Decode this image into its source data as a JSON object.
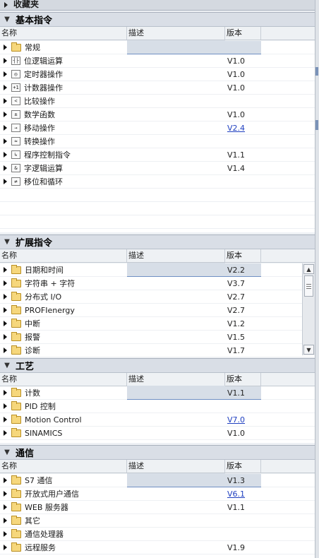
{
  "top_partial": {
    "label": "收藏夹"
  },
  "columns": {
    "name": "名称",
    "desc": "描述",
    "version": "版本"
  },
  "sections": [
    {
      "title": "基本指令",
      "rows": [
        {
          "icon": "folder-icon",
          "label": "常规",
          "version": "",
          "selected": true
        },
        {
          "icon": "bit-logic-icon",
          "glyph": "┤├",
          "label": "位逻辑运算",
          "version": "V1.0"
        },
        {
          "icon": "timer-icon",
          "glyph": "◎",
          "label": "定时器操作",
          "version": "V1.0"
        },
        {
          "icon": "counter-icon",
          "glyph": "+1",
          "label": "计数器操作",
          "version": "V1.0"
        },
        {
          "icon": "compare-icon",
          "glyph": "<",
          "label": "比较操作",
          "version": ""
        },
        {
          "icon": "math-icon",
          "glyph": "±",
          "label": "数学函数",
          "version": "V1.0"
        },
        {
          "icon": "move-icon",
          "glyph": "→",
          "label": "移动操作",
          "version": "V2.4",
          "link": true
        },
        {
          "icon": "convert-icon",
          "glyph": "≈",
          "label": "转换操作",
          "version": ""
        },
        {
          "icon": "program-control-icon",
          "glyph": "↳",
          "label": "程序控制指令",
          "version": "V1.1"
        },
        {
          "icon": "word-logic-icon",
          "glyph": "&",
          "label": "字逻辑运算",
          "version": "V1.4"
        },
        {
          "icon": "shift-rotate-icon",
          "glyph": "⇄",
          "label": "移位和循环",
          "version": ""
        }
      ]
    },
    {
      "title": "扩展指令",
      "rows": [
        {
          "icon": "folder-icon",
          "label": "日期和时间",
          "version": "V2.2",
          "selected": true
        },
        {
          "icon": "folder-icon",
          "label": "字符串 + 字符",
          "version": "V3.7"
        },
        {
          "icon": "folder-icon",
          "label": "分布式 I/O",
          "version": "V2.7"
        },
        {
          "icon": "folder-icon",
          "label": "PROFIenergy",
          "version": "V2.7"
        },
        {
          "icon": "folder-icon",
          "label": "中断",
          "version": "V1.2"
        },
        {
          "icon": "folder-icon",
          "label": "报警",
          "version": "V1.5"
        },
        {
          "icon": "folder-icon",
          "label": "诊断",
          "version": "V1.7"
        }
      ]
    },
    {
      "title": "工艺",
      "rows": [
        {
          "icon": "folder-icon",
          "label": "计数",
          "version": "V1.1",
          "selected": true
        },
        {
          "icon": "folder-icon",
          "label": "PID 控制",
          "version": ""
        },
        {
          "icon": "folder-icon",
          "label": "Motion Control",
          "version": "V7.0",
          "link": true
        },
        {
          "icon": "folder-icon",
          "label": "SINAMICS",
          "version": "V1.0"
        }
      ]
    },
    {
      "title": "通信",
      "rows": [
        {
          "icon": "folder-icon",
          "label": "S7 通信",
          "version": "V1.3",
          "selected": true
        },
        {
          "icon": "folder-icon",
          "label": "开放式用户通信",
          "version": "V6.1",
          "link": true
        },
        {
          "icon": "folder-icon",
          "label": "WEB 服务器",
          "version": "V1.1"
        },
        {
          "icon": "folder-icon",
          "label": "其它",
          "version": ""
        },
        {
          "icon": "folder-icon",
          "label": "通信处理器",
          "version": ""
        },
        {
          "icon": "folder-icon",
          "label": "远程服务",
          "version": "V1.9"
        }
      ]
    }
  ],
  "scrollbar": {
    "up": "▲",
    "down": "▼"
  }
}
